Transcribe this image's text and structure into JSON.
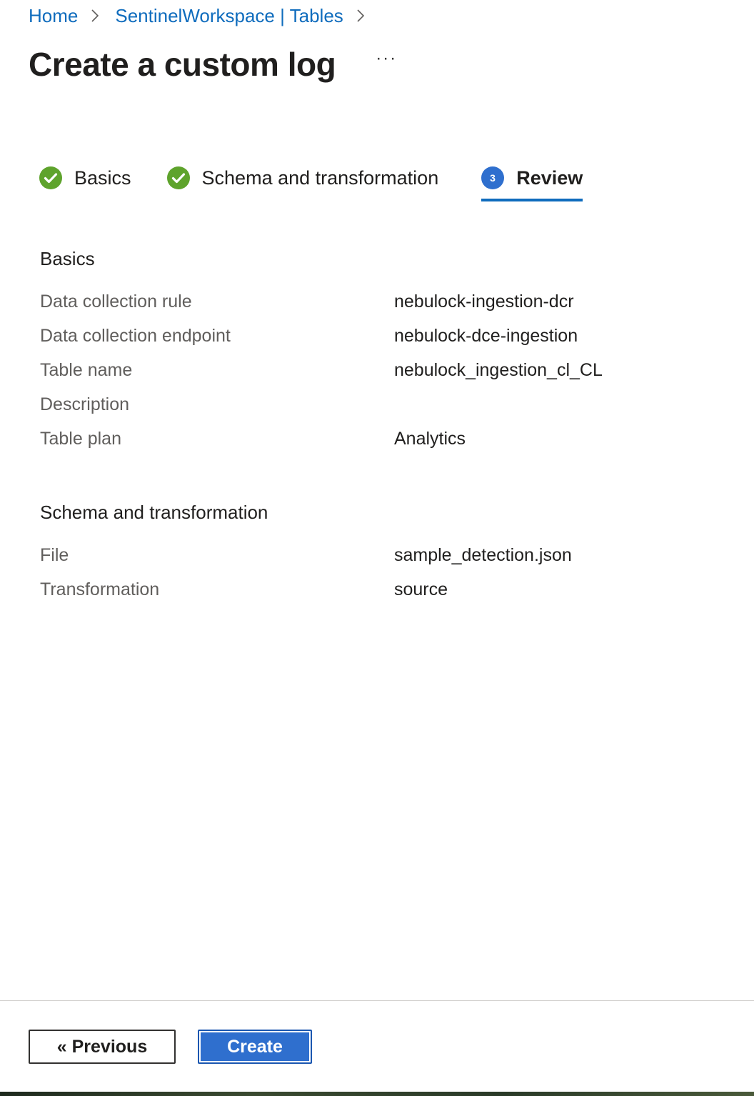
{
  "breadcrumb": {
    "items": [
      "Home",
      "SentinelWorkspace | Tables"
    ]
  },
  "page": {
    "title": "Create a custom log",
    "more_label": "···"
  },
  "steps": [
    {
      "label": "Basics",
      "state": "completed",
      "icon": "check-circle-icon"
    },
    {
      "label": "Schema and transformation",
      "state": "completed",
      "icon": "check-circle-icon"
    },
    {
      "label": "Review",
      "state": "active",
      "number": "3"
    }
  ],
  "review": {
    "basics": {
      "title": "Basics",
      "rows": [
        {
          "label": "Data collection rule",
          "value": "nebulock-ingestion-dcr"
        },
        {
          "label": "Data collection endpoint",
          "value": "nebulock-dce-ingestion"
        },
        {
          "label": "Table name",
          "value": "nebulock_ingestion_cl_CL"
        },
        {
          "label": "Description",
          "value": ""
        },
        {
          "label": "Table plan",
          "value": "Analytics"
        }
      ]
    },
    "schema": {
      "title": "Schema and transformation",
      "rows": [
        {
          "label": "File",
          "value": "sample_detection.json"
        },
        {
          "label": "Transformation",
          "value": "source"
        }
      ]
    }
  },
  "footer": {
    "previous_label": "« Previous",
    "create_label": "Create"
  },
  "colors": {
    "link": "#0f6cbd",
    "success": "#5ea32c",
    "accent": "#2f6fce"
  }
}
